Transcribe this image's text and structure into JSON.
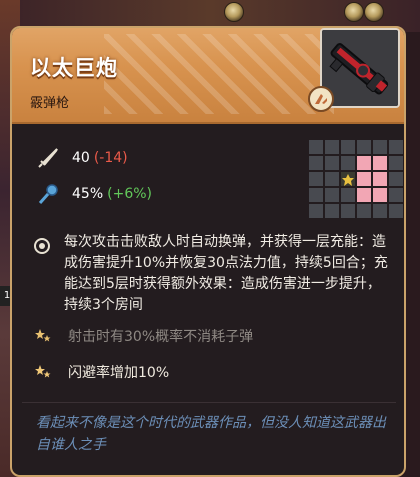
{
  "weapon": {
    "name": "以太巨炮",
    "type": "霰弹枪"
  },
  "stats": {
    "attack": {
      "value": "40",
      "delta": "(-14)",
      "icon": "sword-icon"
    },
    "crit": {
      "value": "45%",
      "delta": "(+6%)",
      "icon": "crit-icon"
    }
  },
  "grid": {
    "cols": 6,
    "rows": 5,
    "pink_cells": [
      [
        3,
        1
      ],
      [
        4,
        1
      ],
      [
        4,
        2
      ],
      [
        3,
        2
      ],
      [
        4,
        3
      ],
      [
        3,
        3
      ]
    ],
    "item_cell": [
      2,
      2
    ]
  },
  "description": {
    "icon": "target-icon",
    "text": "每次攻击击败敌人时自动换弹，并获得一层充能：造成伤害提升10%并恢复30点法力值，持续5回合；充能达到5层时获得额外效果：造成伤害进一步提升，持续3个房间"
  },
  "bonuses": [
    {
      "text": "射击时有30%概率不消耗子弹",
      "active": false,
      "icon": "star-icon"
    },
    {
      "text": "闪避率增加10%",
      "active": true,
      "icon": "star-icon"
    }
  ],
  "flavor": "看起来不像是这个时代的武器作品，但没人知道这武器出自谁人之手",
  "background": {
    "hp_digit": "1"
  },
  "colors": {
    "header": "#d8934f",
    "border": "#caa36a",
    "negative": "#ea5a4a",
    "positive": "#62c85a",
    "flavor": "#6c8fb8",
    "grid_highlight": "#f2a6b4"
  }
}
